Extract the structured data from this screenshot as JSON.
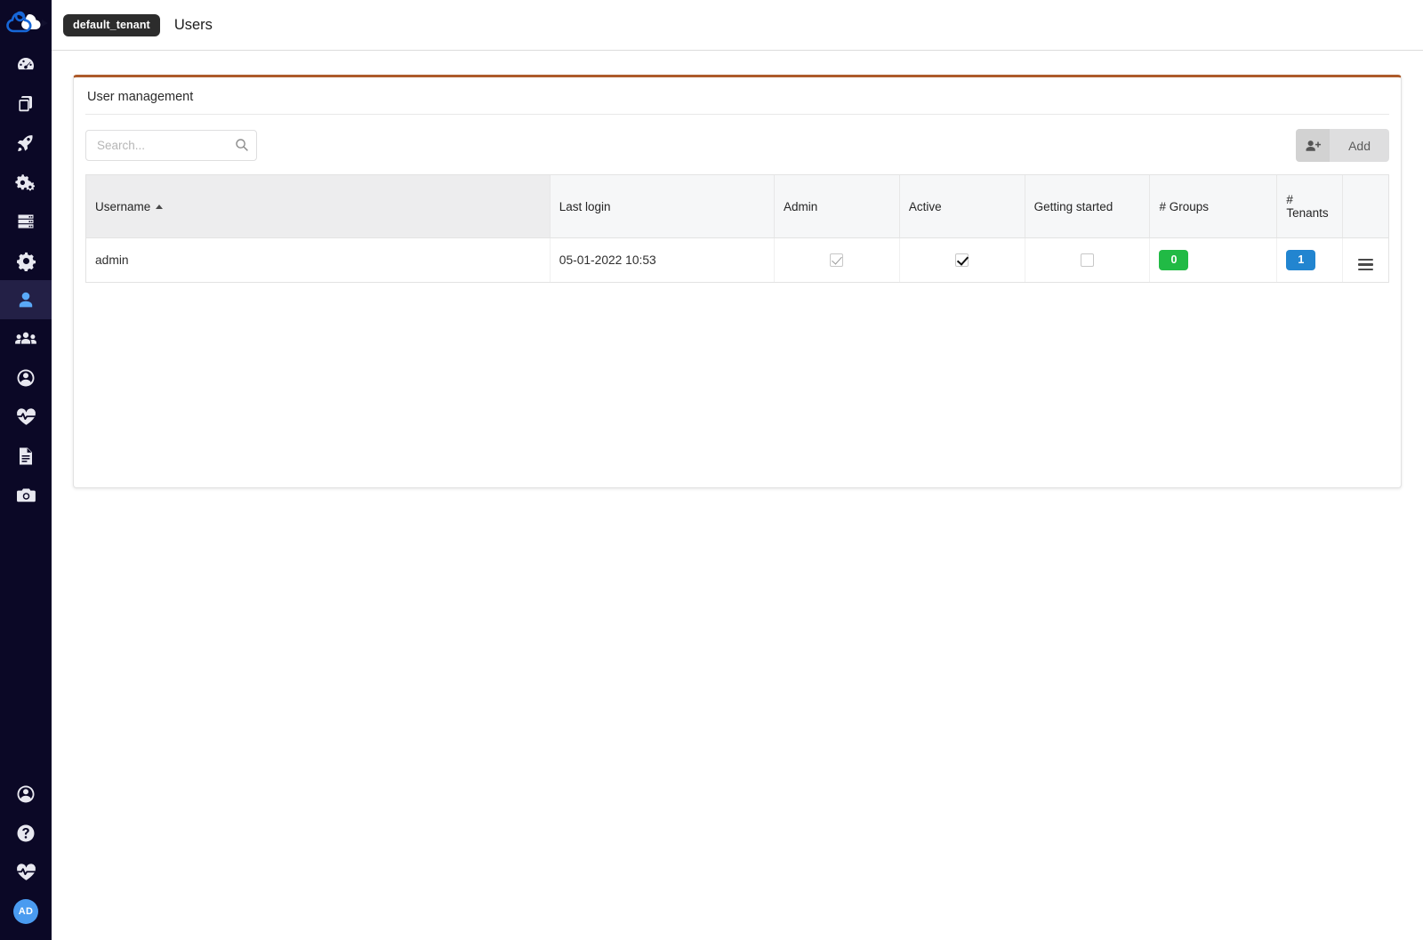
{
  "sidebar": {
    "logo_name": "cloudify-logo",
    "top_items": [
      {
        "name": "dashboard",
        "icon": "gauge-icon",
        "active": false
      },
      {
        "name": "blueprints",
        "icon": "copy-files-icon",
        "active": false
      },
      {
        "name": "deployments",
        "icon": "rocket-icon",
        "active": false
      },
      {
        "name": "executions",
        "icon": "gears-icon",
        "active": false
      },
      {
        "name": "system",
        "icon": "server-stack-icon",
        "active": false
      },
      {
        "name": "settings",
        "icon": "gear-icon",
        "active": false
      },
      {
        "name": "users",
        "icon": "user-icon",
        "active": true
      },
      {
        "name": "user-groups",
        "icon": "users-group-icon",
        "active": false
      },
      {
        "name": "tenants",
        "icon": "user-circle-icon",
        "active": false
      },
      {
        "name": "health",
        "icon": "heartbeat-icon",
        "active": false
      },
      {
        "name": "logs",
        "icon": "document-icon",
        "active": false
      },
      {
        "name": "snapshots",
        "icon": "camera-icon",
        "active": false
      }
    ],
    "bottom_items": [
      {
        "name": "account",
        "icon": "user-circle-icon",
        "active": false
      },
      {
        "name": "help",
        "icon": "question-icon",
        "active": false
      },
      {
        "name": "status",
        "icon": "heartbeat-icon",
        "active": false
      }
    ],
    "avatar_initials": "AD"
  },
  "topbar": {
    "tenant": "default_tenant",
    "page_title": "Users"
  },
  "card": {
    "title": "User management",
    "accent_color": "#ad5b2b"
  },
  "search": {
    "placeholder": "Search...",
    "value": "",
    "icon": "search-icon"
  },
  "add_control": {
    "icon": "add-user-icon",
    "label": "Add"
  },
  "table": {
    "columns": [
      {
        "key": "username",
        "label": "Username",
        "sorted": true,
        "sort_dir": "asc"
      },
      {
        "key": "last_login",
        "label": "Last login",
        "sorted": false,
        "sort_dir": ""
      },
      {
        "key": "admin",
        "label": "Admin",
        "sorted": false,
        "sort_dir": ""
      },
      {
        "key": "active",
        "label": "Active",
        "sorted": false,
        "sort_dir": ""
      },
      {
        "key": "getting",
        "label": "Getting started",
        "sorted": false,
        "sort_dir": ""
      },
      {
        "key": "groups",
        "label": "# Groups",
        "sorted": false,
        "sort_dir": ""
      },
      {
        "key": "tenants",
        "label": "# Tenants",
        "sorted": false,
        "sort_dir": ""
      },
      {
        "key": "actions",
        "label": "",
        "sorted": false,
        "sort_dir": ""
      }
    ],
    "rows": [
      {
        "username": "admin",
        "last_login": "05-01-2022 10:53",
        "admin_checked": true,
        "admin_disabled": true,
        "active_checked": true,
        "active_disabled": false,
        "getting_started_checked": false,
        "groups_count": "0",
        "groups_color": "#21ba45",
        "tenants_count": "1",
        "tenants_color": "#2285d0",
        "actions_icon": "hamburger-menu-icon"
      }
    ]
  }
}
